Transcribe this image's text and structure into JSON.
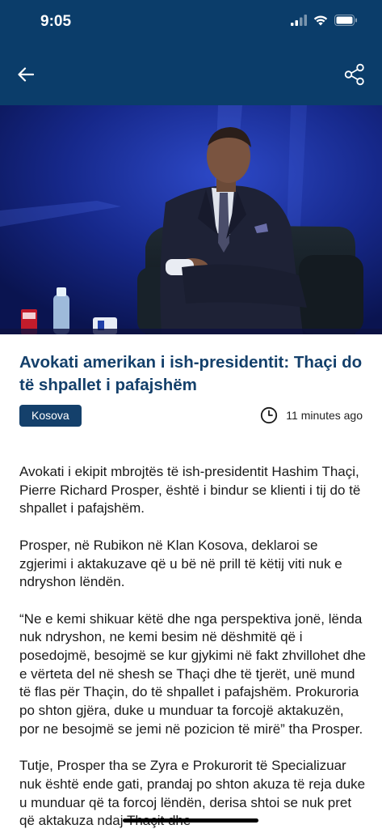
{
  "status_bar": {
    "time": "9:05"
  },
  "app_bar": {
    "back_icon": "arrow-left-icon",
    "share_icon": "share-icon",
    "background": "#0b3d6a"
  },
  "article": {
    "title": "Avokati amerikan i ish-presidentit: Thaçi do të shpallet i pafajshëm",
    "category": "Kosova",
    "time_ago": "11 minutes ago",
    "paragraphs": [
      "Avokati i ekipit mbrojtës të ish-presidentit Hashim Thaçi, Pierre Richard Prosper, është i bindur se klienti i tij do të shpallet i pafajshëm.",
      "Prosper, në Rubikon në Klan Kosova, deklaroi se zgjerimi i aktakuzave që u bë në prill të këtij viti nuk e ndryshon lëndën.",
      "“Ne e kemi shikuar këtë dhe nga perspektiva jonë, lënda nuk ndryshon, ne kemi besim në dëshmitë që i posedojmë, besojmë se kur gjykimi në fakt zhvillohet dhe e vërteta del në shesh se Thaçi dhe të tjerët, unë mund të flas për Thaçin, do të shpallet i pafajshëm. Prokuroria po shton gjëra, duke u munduar ta forcojë aktakuzën, por ne besojmë se jemi në pozicion të mirë” tha Prosper.",
      "Tutje, Prosper tha se Zyra e Prokurorit të Specializuar nuk është ende gati, prandaj po shton akuza të reja duke u munduar që ta forcoj lëndën, derisa shtoi se nuk pret që aktakuza ndaj Thaçit dhe"
    ]
  },
  "colors": {
    "primary": "#14406b",
    "text": "#1a1a1a"
  }
}
